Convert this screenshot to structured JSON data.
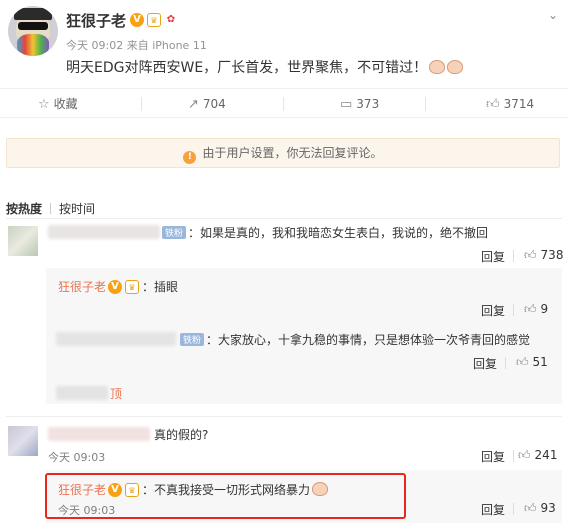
{
  "post": {
    "author": "狂很子老",
    "meta": "今天 09:02 来自 iPhone 11",
    "text": "明天EDG对阵西安WE，厂长首发，世界聚焦，不可错过！",
    "badge_v": "V"
  },
  "actions": {
    "favorite_label": "收藏",
    "repost_count": "704",
    "comment_count": "373",
    "like_count": "3714"
  },
  "notice": {
    "text": "由于用户设置，你无法回复评论。",
    "icon_char": "!"
  },
  "sort": {
    "hot": "按热度",
    "time": "按时间"
  },
  "comments": [
    {
      "fan_tag": "铁粉",
      "text": "：如果是真的，我和我暗恋女生表白，我说的，绝不撤回",
      "reply": "回复",
      "likes": "738"
    },
    {
      "author": "狂很子老",
      "text": "：插眼",
      "reply": "回复",
      "likes": "9"
    },
    {
      "fan_tag": "铁粉",
      "text": "：大家放心，十拿九稳的事情，只是想体验一次爷青回的感觉",
      "reply": "回复",
      "likes": "51"
    },
    {
      "tail": "顶"
    },
    {
      "text": "真的假的?",
      "time": "今天 09:03",
      "reply": "回复",
      "likes": "241"
    },
    {
      "author": "狂很子老",
      "text": "：不真我接受一切形式网络暴力",
      "time": "今天 09:03",
      "reply": "回复",
      "likes": "93"
    }
  ],
  "icons": {
    "more": "chevron-down-icon",
    "favorite": "star-icon",
    "repost": "repost-icon",
    "comment": "comment-icon",
    "like": "thumb-up-icon"
  },
  "colors": {
    "name_orange": "#eb7350",
    "notice_bg": "#fcf5ec",
    "highlight_red": "#e8281f",
    "verified_gold": "#f7a113"
  }
}
